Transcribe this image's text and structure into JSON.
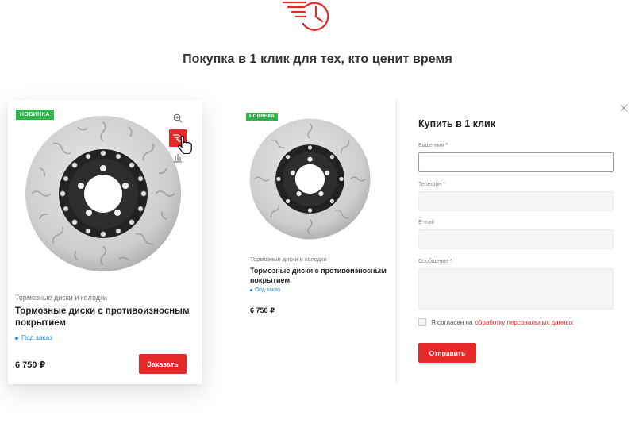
{
  "header": {
    "icon": "fast-clock-icon",
    "headline": "Покупка в 1 клик для тех, кто ценит время"
  },
  "product_card": {
    "badge": "НОВИНКА",
    "category": "Тормозные диски и колодки",
    "title": "Тормозные диски с противоизносным покрытием",
    "status": "Под заказ",
    "price": "6 750 ₽",
    "order_button": "Заказать",
    "hover_icons": [
      "zoom-icon",
      "quick-buy-icon",
      "compare-icon"
    ]
  },
  "modal": {
    "product": {
      "badge": "НОВИНКА",
      "category": "Тормозные диски и колодки",
      "title": "Тормозные диски с противоизносным покрытием",
      "status": "Под заказ",
      "price": "6 750 ₽"
    },
    "form": {
      "title": "Купить в 1 клик",
      "fields": {
        "name": {
          "label": "Ваше имя",
          "required": "*",
          "value": ""
        },
        "phone": {
          "label": "Телефон",
          "required": "*",
          "value": ""
        },
        "email": {
          "label": "E-mail",
          "value": ""
        },
        "message": {
          "label": "Сообщение",
          "required": "*",
          "value": ""
        }
      },
      "consent_text": "Я согласен на",
      "consent_link": "обработку персональных данных",
      "submit": "Отправить"
    }
  },
  "colors": {
    "accent": "#e52828",
    "badge": "#2fb34a",
    "status": "#1f8fd6"
  }
}
